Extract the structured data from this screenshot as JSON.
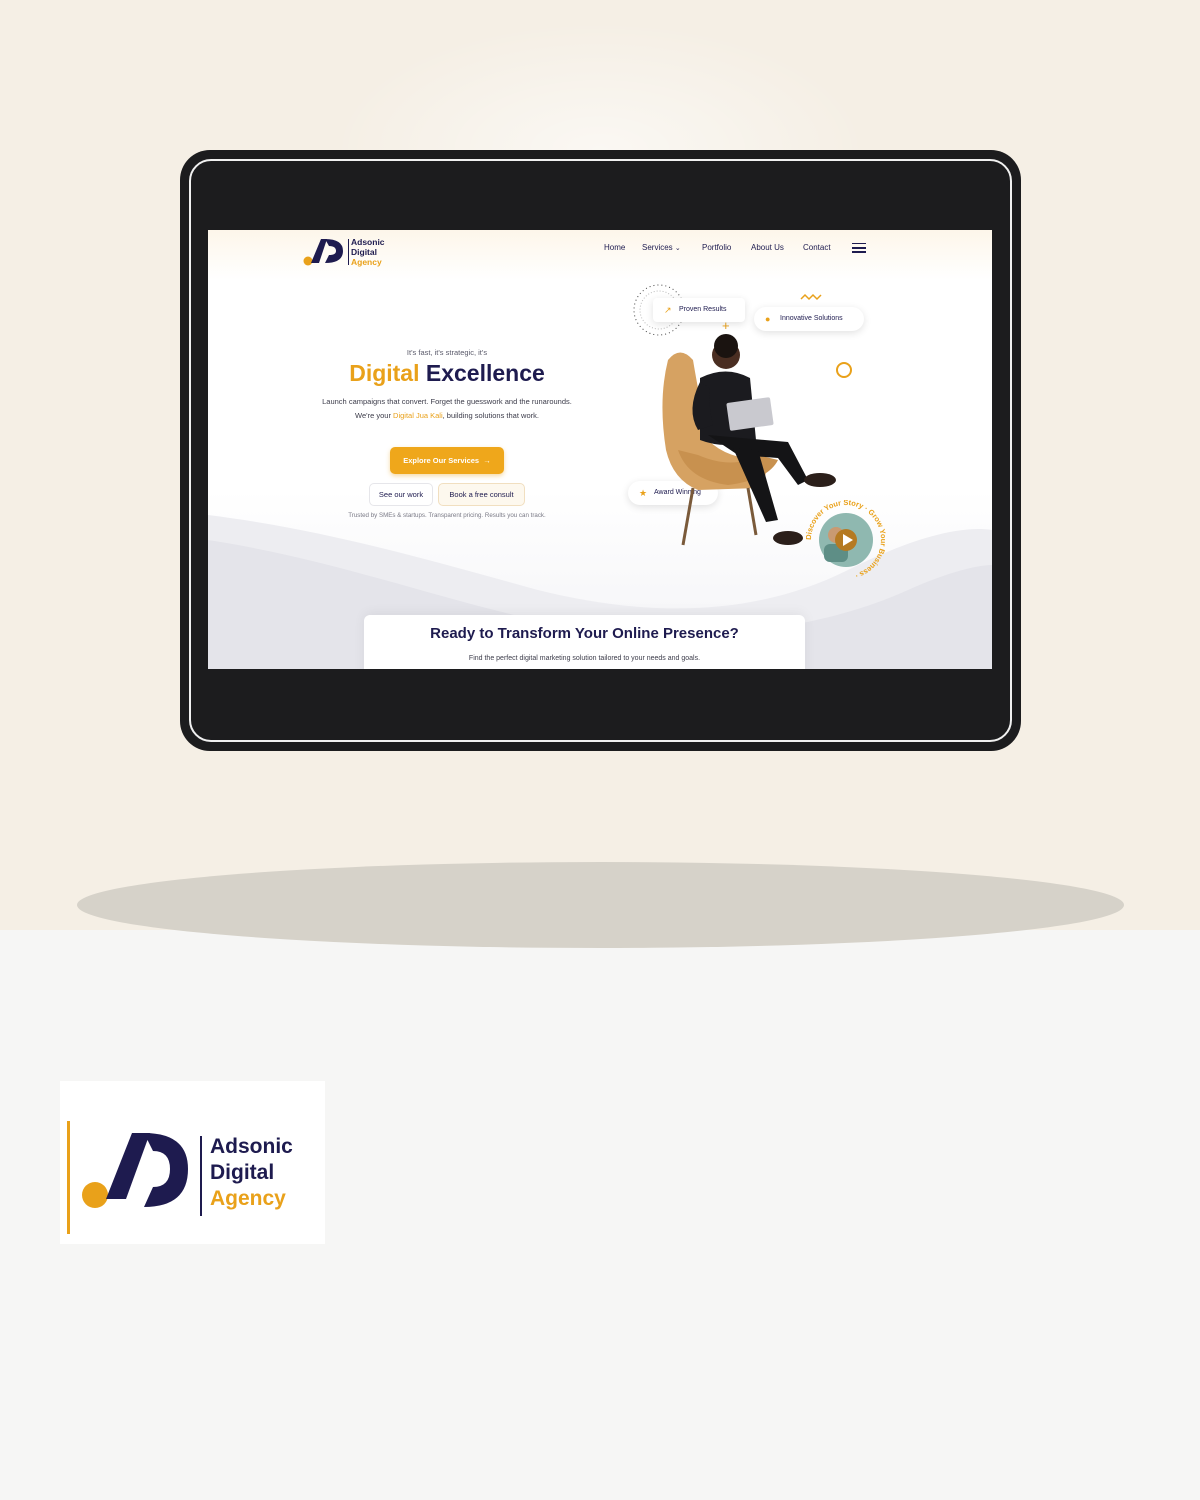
{
  "brand": {
    "name_line1": "Adsonic",
    "name_line2": "Digital",
    "name_line3": "Agency",
    "colors": {
      "navy": "#1e1b4f",
      "orange": "#e9a11a",
      "background": "#f5efe5"
    }
  },
  "nav": {
    "home": "Home",
    "services": "Services",
    "portfolio": "Portfolio",
    "about": "About Us",
    "contact": "Contact"
  },
  "hero": {
    "eyebrow": "It's fast, it's strategic, it's",
    "headline_accent": "Digital",
    "headline_rest": "Excellence",
    "desc_part1": "Launch campaigns that convert. Forget the guesswork and the runarounds. We're your ",
    "desc_accent": "Digital Jua Kali",
    "desc_part2": ", building solutions that work.",
    "cta_primary": "Explore Our Services",
    "cta_work": "See our work",
    "cta_consult": "Book a free consult",
    "trust": "Trusted by SMEs & startups. Transparent pricing. Results you can track."
  },
  "badges": {
    "proven": "Proven Results",
    "innovative": "Innovative Solutions",
    "award": "Award Winning"
  },
  "video": {
    "ring_text": "Discover Your Story · Grow Your Business ·"
  },
  "cta_card": {
    "title": "Ready to Transform Your Online Presence?",
    "subtitle": "Find the perfect digital marketing solution tailored to your needs and goals."
  }
}
